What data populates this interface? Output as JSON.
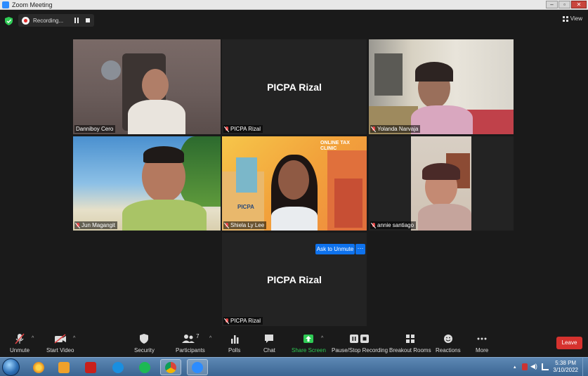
{
  "window": {
    "title": "Zoom Meeting"
  },
  "recording": {
    "label": "Recording..."
  },
  "view": {
    "label": "View"
  },
  "participants": [
    {
      "name": "Danniboy Cero",
      "video": true,
      "active_speaker": true
    },
    {
      "name": "PICPA Rizal",
      "video": false,
      "display_name": "PICPA Rizal"
    },
    {
      "name": "Yolanda Narvaja",
      "video": true
    },
    {
      "name": "Jun Magangit",
      "video": true
    },
    {
      "name": "Shiela Ly Lee",
      "video": true,
      "background_text": "ONLINE TAX CLINIC",
      "background_logo": "PICPA"
    },
    {
      "name": "annie santiago",
      "video": true
    },
    {
      "name": "PICPA Rizal",
      "video": false,
      "display_name": "PICPA Rizal"
    }
  ],
  "tile_actions": {
    "ask_to_unmute": "Ask to Unmute",
    "more": "···"
  },
  "toolbar": {
    "unmute": "Unmute",
    "start_video": "Start Video",
    "security": "Security",
    "participants": "Participants",
    "participants_count": "7",
    "polls": "Polls",
    "chat": "Chat",
    "share_screen": "Share Screen",
    "pause_stop_recording": "Pause/Stop Recording",
    "breakout_rooms": "Breakout Rooms",
    "reactions": "Reactions",
    "more": "More",
    "leave": "Leave"
  },
  "taskbar": {
    "apps": [
      "ie-icon",
      "chrome-icon",
      "media-player-icon",
      "acrobat-icon",
      "edge-icon",
      "spotify-icon",
      "chrome-icon",
      "zoom-icon"
    ],
    "time": "5:38 PM",
    "date": "3/10/2022"
  },
  "colors": {
    "accent": "#0e72ed",
    "share_green": "#2fcb55",
    "leave_red": "#d6322e",
    "active_outline": "#d6e04a"
  }
}
